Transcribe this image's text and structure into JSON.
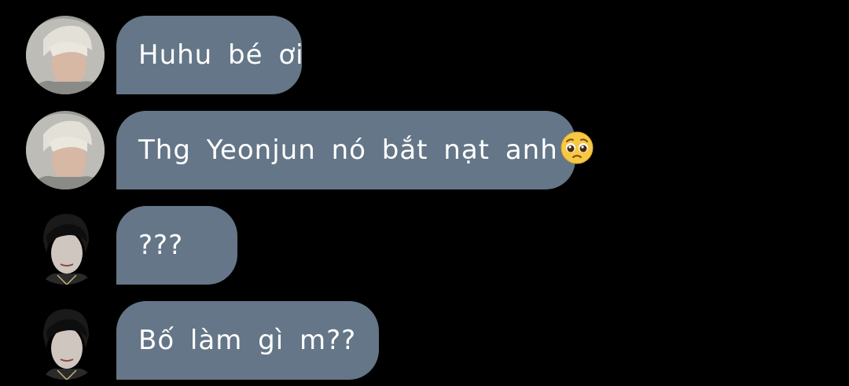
{
  "messages": [
    {
      "sender": "avatar-light-hair",
      "text": "Huhu bé ơi"
    },
    {
      "sender": "avatar-light-hair",
      "text": "Thg Yeonjun nó bắt nạt anh",
      "emoji": "pleading-face-icon"
    },
    {
      "sender": "avatar-dark-hair",
      "text": "???"
    },
    {
      "sender": "avatar-dark-hair",
      "text": "Bố làm gì m??"
    }
  ],
  "colors": {
    "background": "#000000",
    "bubble": "#647687",
    "text": "#ffffff"
  }
}
